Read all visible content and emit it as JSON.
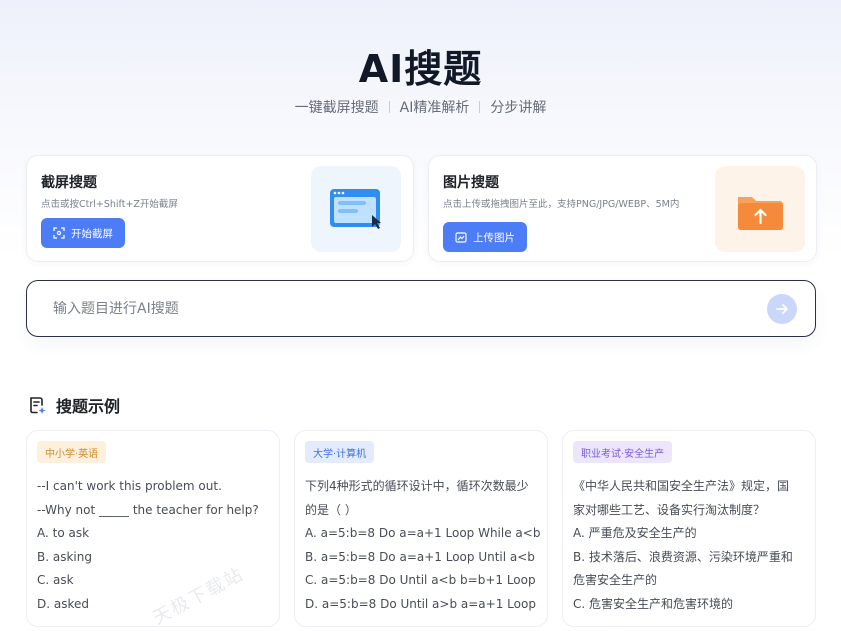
{
  "header": {
    "title": "AI搜题",
    "subtitle_items": [
      "一键截屏搜题",
      "AI精准解析",
      "分步讲解"
    ]
  },
  "screenshot_card": {
    "title": "截屏搜题",
    "desc": "点击或按Ctrl+Shift+Z开始截屏",
    "button_label": "开始截屏",
    "icon": "screen-capture-icon"
  },
  "image_card": {
    "title": "图片搜题",
    "desc": "点击上传或拖拽图片至此，支持PNG/JPG/WEBP、5M内",
    "button_label": "上传图片",
    "icon": "upload-folder-icon"
  },
  "search": {
    "placeholder": "输入题目进行AI搜题",
    "send_icon": "arrow-right-icon"
  },
  "examples_section": {
    "title": "搜题示例",
    "icon": "document-sparkle-icon",
    "items": [
      {
        "tag": "中小学·英语",
        "lines": [
          "--I can't work this problem out.",
          "--Why not _____ the teacher for help?",
          "A. to ask",
          "B. asking",
          "C. ask",
          "D. asked"
        ]
      },
      {
        "tag": "大学·计算机",
        "lines": [
          "下列4种形式的循环设计中，循环次数最少",
          "的是（ ）",
          "A. a=5:b=8 Do a=a+1 Loop While a<b",
          "B. a=5:b=8 Do a=a+1 Loop Until a<b",
          "C. a=5:b=8 Do Until a<b b=b+1 Loop",
          "D. a=5:b=8 Do Until a>b a=a+1 Loop"
        ]
      },
      {
        "tag": "职业考试·安全生产",
        "lines": [
          "《中华人民共和国安全生产法》规定，国",
          "家对哪些工艺、设备实行淘汰制度？",
          "A. 严重危及安全生产的",
          "B. 技术落后、浪费资源、污染环境严重和",
          "危害安全生产的",
          "C. 危害安全生产和危害环境的"
        ]
      }
    ]
  },
  "watermark": "天极下载站",
  "colors": {
    "primary": "#4d7cf7",
    "tag_k12_bg": "#fdf0dc",
    "tag_k12_fg": "#d08a2a",
    "tag_college_bg": "#e3ecfd",
    "tag_college_fg": "#3f6fe0",
    "tag_pro_bg": "#ece6fc",
    "tag_pro_fg": "#7a5ad6"
  }
}
